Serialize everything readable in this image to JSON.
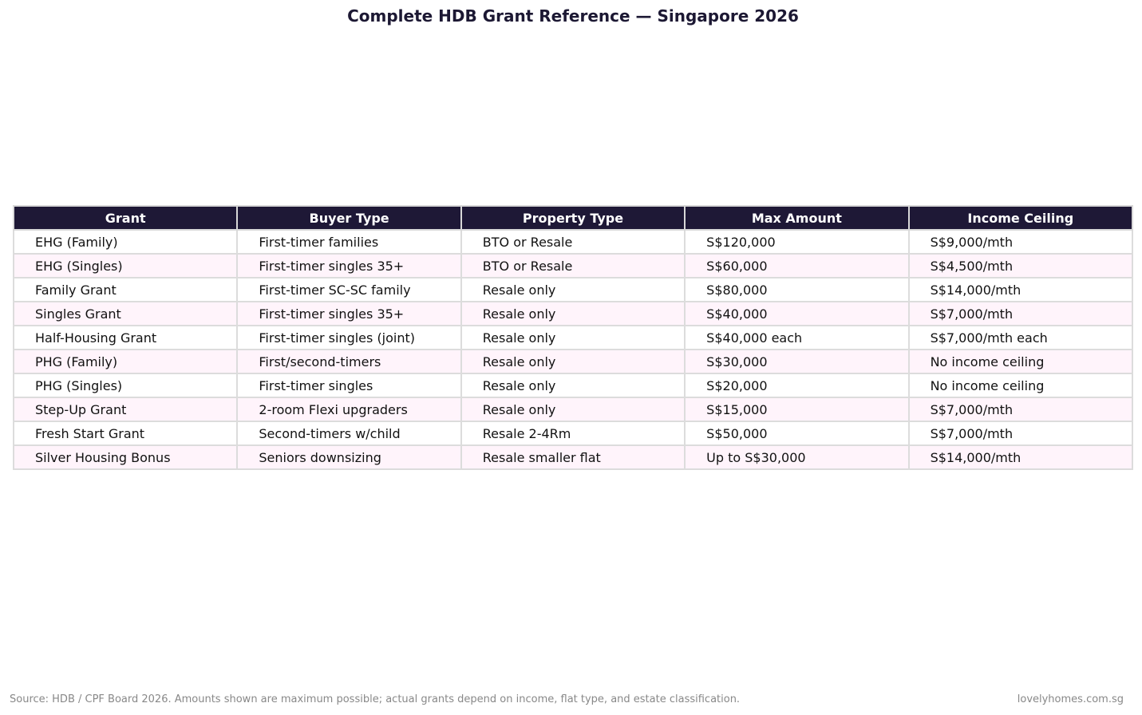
{
  "title": "Complete HDB Grant Reference — Singapore 2026",
  "chart_data": {
    "type": "table",
    "title": "Complete HDB Grant Reference — Singapore 2026",
    "columns": [
      "Grant",
      "Buyer Type",
      "Property Type",
      "Max Amount",
      "Income Ceiling"
    ],
    "rows": [
      [
        "EHG (Family)",
        "First-timer families",
        "BTO or Resale",
        "S$120,000",
        "S$9,000/mth"
      ],
      [
        "EHG (Singles)",
        "First-timer singles 35+",
        "BTO or Resale",
        "S$60,000",
        "S$4,500/mth"
      ],
      [
        "Family Grant",
        "First-timer SC-SC family",
        "Resale only",
        "S$80,000",
        "S$14,000/mth"
      ],
      [
        "Singles Grant",
        "First-timer singles 35+",
        "Resale only",
        "S$40,000",
        "S$7,000/mth"
      ],
      [
        "Half-Housing Grant",
        "First-timer singles (joint)",
        "Resale only",
        "S$40,000 each",
        "S$7,000/mth each"
      ],
      [
        "PHG (Family)",
        "First/second-timers",
        "Resale only",
        "S$30,000",
        "No income ceiling"
      ],
      [
        "PHG (Singles)",
        "First-timer singles",
        "Resale only",
        "S$20,000",
        "No income ceiling"
      ],
      [
        "Step-Up Grant",
        "2-room Flexi upgraders",
        "Resale only",
        "S$15,000",
        "S$7,000/mth"
      ],
      [
        "Fresh Start Grant",
        "Second-timers w/child",
        "Resale 2-4Rm",
        "S$50,000",
        "S$7,000/mth"
      ],
      [
        "Silver Housing Bonus",
        "Seniors downsizing",
        "Resale smaller flat",
        "Up to S$30,000",
        "S$14,000/mth"
      ]
    ],
    "colors": {
      "header_bg": "#1e1836",
      "header_text": "#ffffff",
      "row_alt_bg": "#fff4fb",
      "row_bg": "#ffffff",
      "border": "#dcdcdc",
      "title_color": "#1c1833"
    }
  },
  "footer": {
    "source": "Source: HDB / CPF Board 2026. Amounts shown are maximum possible; actual grants depend on income, flat type, and estate classification.",
    "site": "lovelyhomes.com.sg"
  }
}
